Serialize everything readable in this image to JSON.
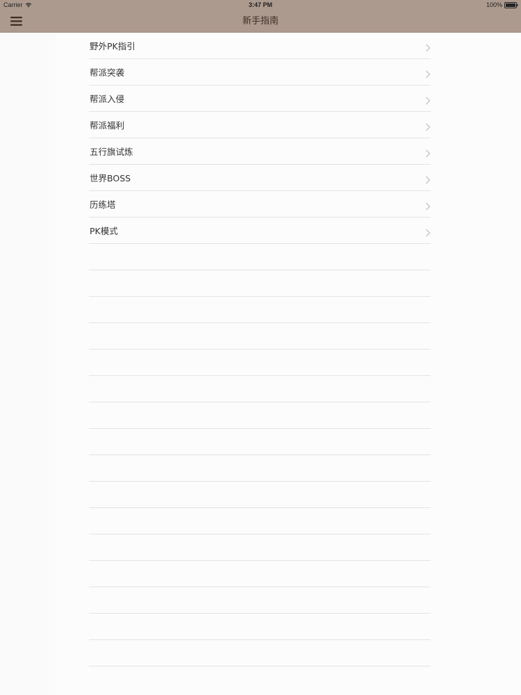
{
  "status_bar": {
    "carrier": "Carrier",
    "time": "3:47 PM",
    "battery": "100%"
  },
  "nav": {
    "title": "新手指南",
    "menu_icon": "hamburger-menu-icon"
  },
  "colors": {
    "nav_background": "#ad9a8e",
    "separator": "#e4e2e4",
    "text": "#333333",
    "chevron": "#c4c4c8"
  },
  "guide": {
    "items": [
      {
        "label": "野外PK指引"
      },
      {
        "label": "帮派突袭"
      },
      {
        "label": "帮派入侵"
      },
      {
        "label": "帮派福利"
      },
      {
        "label": "五行旗试炼"
      },
      {
        "label": "世界BOSS"
      },
      {
        "label": "历练塔"
      },
      {
        "label": "PK模式"
      }
    ]
  }
}
